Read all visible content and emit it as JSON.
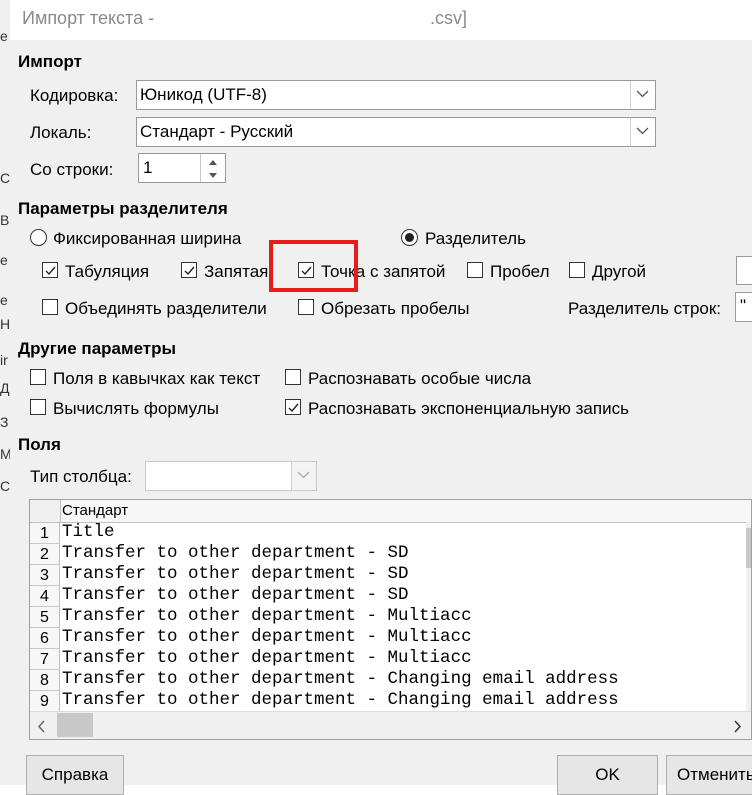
{
  "window": {
    "title": "Импорт текста -",
    "title_suffix": ".csv]"
  },
  "left_strip": [
    "е",
    "С",
    "В",
    "е",
    "е",
    "Н",
    "ir",
    "Д",
    "З",
    "М",
    "С"
  ],
  "import": {
    "section": "Импорт",
    "encoding_label": "Кодировка:",
    "encoding_value": "Юникод (UTF-8)",
    "locale_label": "Локаль:",
    "locale_value": "Стандарт - Русский",
    "from_row_label": "Со строки:",
    "from_row_value": "1"
  },
  "separator": {
    "section": "Параметры разделителя",
    "fixed_width": "Фиксированная ширина",
    "separated": "Разделитель",
    "mode": "separated",
    "tab": "Табуляция",
    "comma": "Запятая",
    "semicolon": "Точка с запятой",
    "space": "Пробел",
    "other": "Другой",
    "merge": "Объединять разделители",
    "trim": "Обрезать пробелы",
    "string_delim_label": "Разделитель строк:",
    "string_delim_value": "\"",
    "checked": {
      "tab": true,
      "comma": true,
      "semicolon": true,
      "space": false,
      "other": false,
      "merge": false,
      "trim": false
    },
    "highlight_color": "#e51c1c"
  },
  "other": {
    "section": "Другие параметры",
    "quoted_as_text": "Поля в кавычках как текст",
    "detect_special": "Распознавать особые числа",
    "evaluate_formulas": "Вычислять формулы",
    "detect_scientific": "Распознавать экспоненциальную запись",
    "checked": {
      "quoted_as_text": false,
      "detect_special": false,
      "evaluate_formulas": false,
      "detect_scientific": true
    }
  },
  "fields": {
    "section": "Поля",
    "column_type_label": "Тип столбца:",
    "column_type_value": "",
    "column_header": "Стандарт",
    "rows": [
      {
        "num": "1",
        "text": "Title"
      },
      {
        "num": "2",
        "text": "Transfer to other department - SD"
      },
      {
        "num": "3",
        "text": "Transfer to other department - SD"
      },
      {
        "num": "4",
        "text": "Transfer to other department - SD"
      },
      {
        "num": "5",
        "text": "Transfer to other department - Multiacc"
      },
      {
        "num": "6",
        "text": "Transfer to other department - Multiacc"
      },
      {
        "num": "7",
        "text": "Transfer to other department - Multiacc"
      },
      {
        "num": "8",
        "text": "Transfer to other department - Changing email address"
      },
      {
        "num": "9",
        "text": "Transfer to other department - Changing email address"
      }
    ]
  },
  "buttons": {
    "help": "Справка",
    "ok": "OK",
    "cancel": "Отменить"
  }
}
